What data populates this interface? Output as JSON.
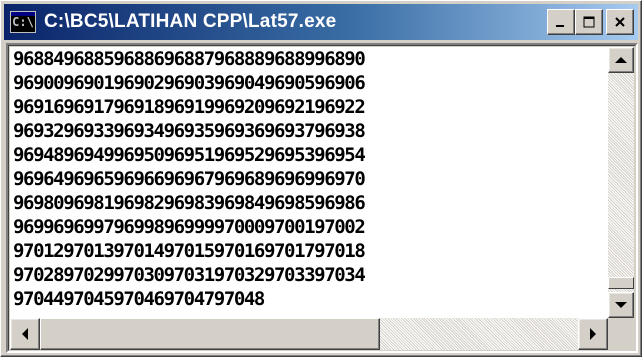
{
  "window": {
    "title": "C:\\BC5\\LATIHAN CPP\\Lat57.exe",
    "icon_label": "C:\\",
    "icon_name": "console-window-icon",
    "accent": "#0a246a",
    "buttons": {
      "minimize": "minimize-icon",
      "maximize": "maximize-icon",
      "close": "close-icon"
    }
  },
  "console": {
    "lines": [
      "96884968859688696887968889688996890",
      "96900969019690296903969049690596906",
      "96916969179691896919969209692196922",
      "96932969339693496935969369693796938",
      "96948969499695096951969529695396954",
      "96964969659696696967969689696996970",
      "96980969819698296983969849698596986",
      "96996969979699896999970009700197002",
      "97012970139701497015970169701797018",
      "97028970299703097031970329703397034",
      "9704497045970469704797048"
    ],
    "background": "#ffffff",
    "foreground": "#000000"
  },
  "scrollbars": {
    "vertical": {
      "up": "scroll-up-icon",
      "down": "scroll-down-icon",
      "position": 0.9
    },
    "horizontal": {
      "left": "scroll-left-icon",
      "right": "scroll-right-icon",
      "position": 0.0
    }
  }
}
